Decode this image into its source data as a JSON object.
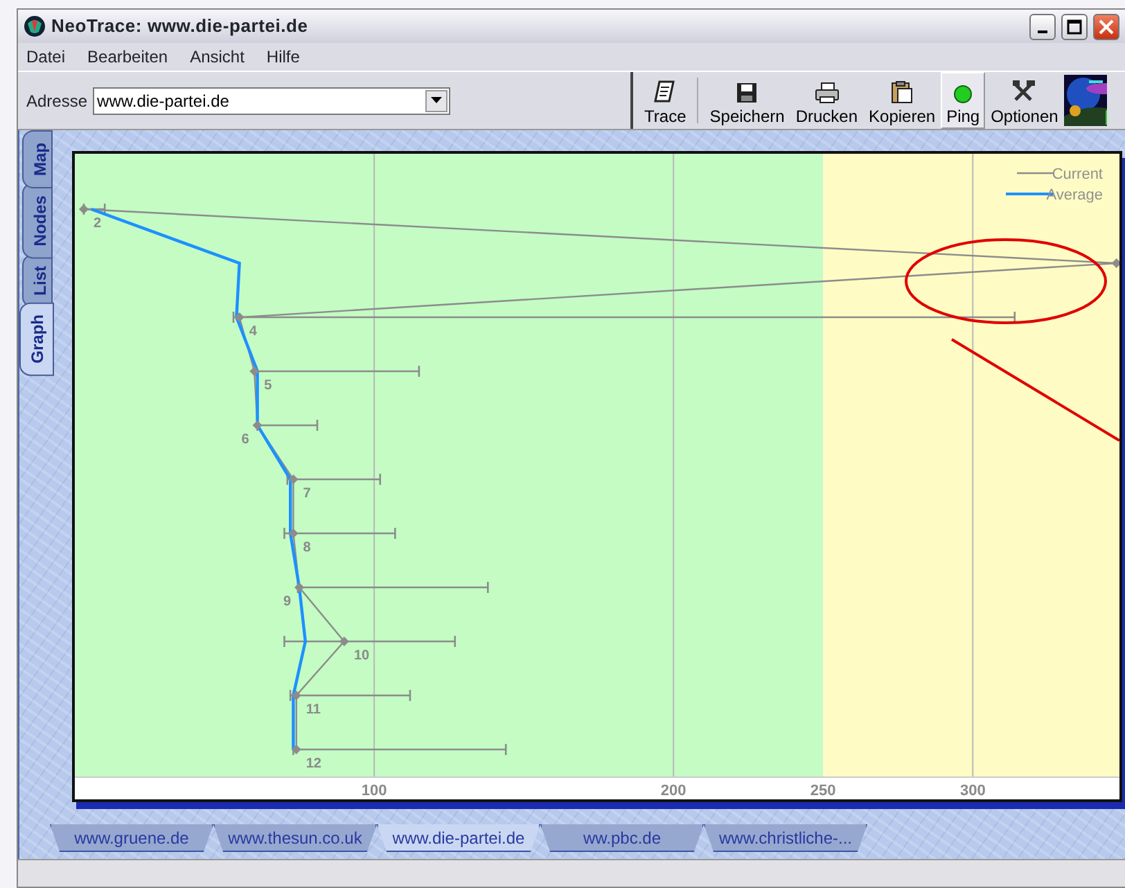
{
  "window": {
    "title": "NeoTrace: www.die-partei.de"
  },
  "menu": [
    "Datei",
    "Bearbeiten",
    "Ansicht",
    "Hilfe"
  ],
  "address": {
    "label": "Adresse",
    "value": "www.die-partei.de"
  },
  "toolbar": [
    {
      "label": "Trace",
      "kind": "trace",
      "pressed": false
    },
    {
      "label": "Speichern",
      "kind": "save",
      "pressed": false
    },
    {
      "label": "Drucken",
      "kind": "print",
      "pressed": false
    },
    {
      "label": "Kopieren",
      "kind": "copy",
      "pressed": false
    },
    {
      "label": "Ping",
      "kind": "ping",
      "pressed": true
    },
    {
      "label": "Optionen",
      "kind": "options",
      "pressed": false
    }
  ],
  "logo": {
    "kind": "picture"
  },
  "side_tabs": [
    {
      "label": "Map",
      "selected": false
    },
    {
      "label": "Nodes",
      "selected": false
    },
    {
      "label": "List",
      "selected": false
    },
    {
      "label": "Graph",
      "selected": true
    }
  ],
  "chart_data": {
    "type": "line",
    "orientation": "horizontal",
    "categories": [
      "2",
      null,
      "4",
      "5",
      "6",
      "7",
      "8",
      "9",
      "10",
      "11",
      "12"
    ],
    "xlim": [
      0,
      349
    ],
    "xticks": [
      100,
      200,
      250,
      300
    ],
    "grid": true,
    "bands": [
      {
        "axis": "x",
        "from": 0,
        "to": 250,
        "color": "#c4fcc4"
      },
      {
        "axis": "x",
        "from": 250,
        "to": 349,
        "color": "#fefcc4"
      }
    ],
    "series": [
      {
        "name": "Current",
        "color": "#8c8c8c",
        "marker": "diamond",
        "values": [
          3,
          348,
          55,
          60,
          61,
          73,
          73,
          75,
          90,
          74,
          74
        ],
        "errors": [
          [
            3,
            10
          ],
          null,
          [
            53,
            314
          ],
          [
            60.6,
            115
          ],
          [
            61,
            81
          ],
          [
            71,
            102
          ],
          [
            70,
            107
          ],
          [
            74.5,
            138
          ],
          [
            70,
            127
          ],
          [
            72,
            112
          ],
          [
            73,
            144
          ]
        ]
      },
      {
        "name": "Average",
        "color": "#1e90ff",
        "values": [
          5.5,
          55,
          54,
          61,
          61,
          72,
          72,
          75,
          77,
          73,
          73
        ]
      }
    ]
  },
  "markup": {
    "kind": "ellipse-with-pointer",
    "color": "#e00000"
  },
  "site_tabs": [
    {
      "label": "www.gruene.de",
      "selected": false
    },
    {
      "label": "www.thesun.co.uk",
      "selected": false
    },
    {
      "label": "www.die-partei.de",
      "selected": true
    },
    {
      "label": "ww.pbc.de",
      "selected": false
    },
    {
      "label": "www.christliche-...",
      "selected": false
    }
  ]
}
